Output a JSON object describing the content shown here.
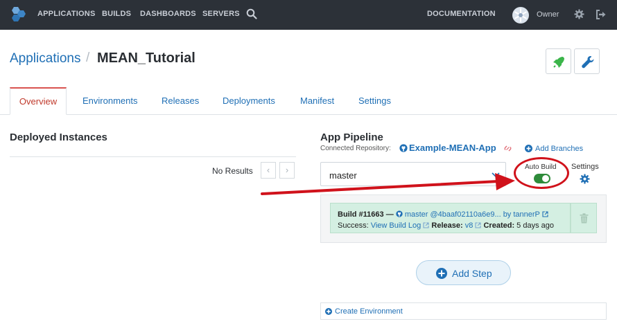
{
  "nav": {
    "applications": "APPLICATIONS",
    "builds": "BUILDS",
    "dashboards": "DASHBOARDS",
    "servers": "SERVERS",
    "documentation": "DOCUMENTATION",
    "user": "Owner",
    "search_icon": "search-icon",
    "settings_icon": "gear-icon",
    "logout_icon": "logout-icon"
  },
  "header": {
    "breadcrumb_root": "Applications",
    "separator": "/",
    "title": "MEAN_Tutorial",
    "deploy_icon": "rocket-icon",
    "tools_icon": "wrench-icon"
  },
  "tabs": [
    {
      "label": "Overview",
      "active": true
    },
    {
      "label": "Environments"
    },
    {
      "label": "Releases"
    },
    {
      "label": "Deployments"
    },
    {
      "label": "Manifest"
    },
    {
      "label": "Settings"
    }
  ],
  "deployed": {
    "title": "Deployed Instances",
    "empty": "No Results",
    "prev": "‹",
    "next": "›"
  },
  "pipeline": {
    "title": "App Pipeline",
    "repo_label": "Connected Repository:",
    "repo_name": "Example-MEAN-App",
    "add_branches": "Add Branches",
    "branch": "master",
    "auto_build_label": "Auto Build",
    "auto_build_on": true,
    "settings_label": "Settings",
    "build": {
      "number": "Build #11663 —",
      "commit": "master @4baaf02110a6e9...",
      "author": "by tannerP",
      "status_label": "Success:",
      "log_link": "View Build Log",
      "release_label": "Release:",
      "release": "v8",
      "created_label": "Created:",
      "created": "5 days ago"
    },
    "add_step": "Add Step",
    "create_env": "Create Environment"
  },
  "colors": {
    "nav_bg": "#2c3138",
    "link": "#1f6fb5",
    "active_tab": "#d9534f",
    "toggle_on": "#2e8b3a",
    "annotation": "#d0121b",
    "build_success_bg": "#d4efe2"
  }
}
